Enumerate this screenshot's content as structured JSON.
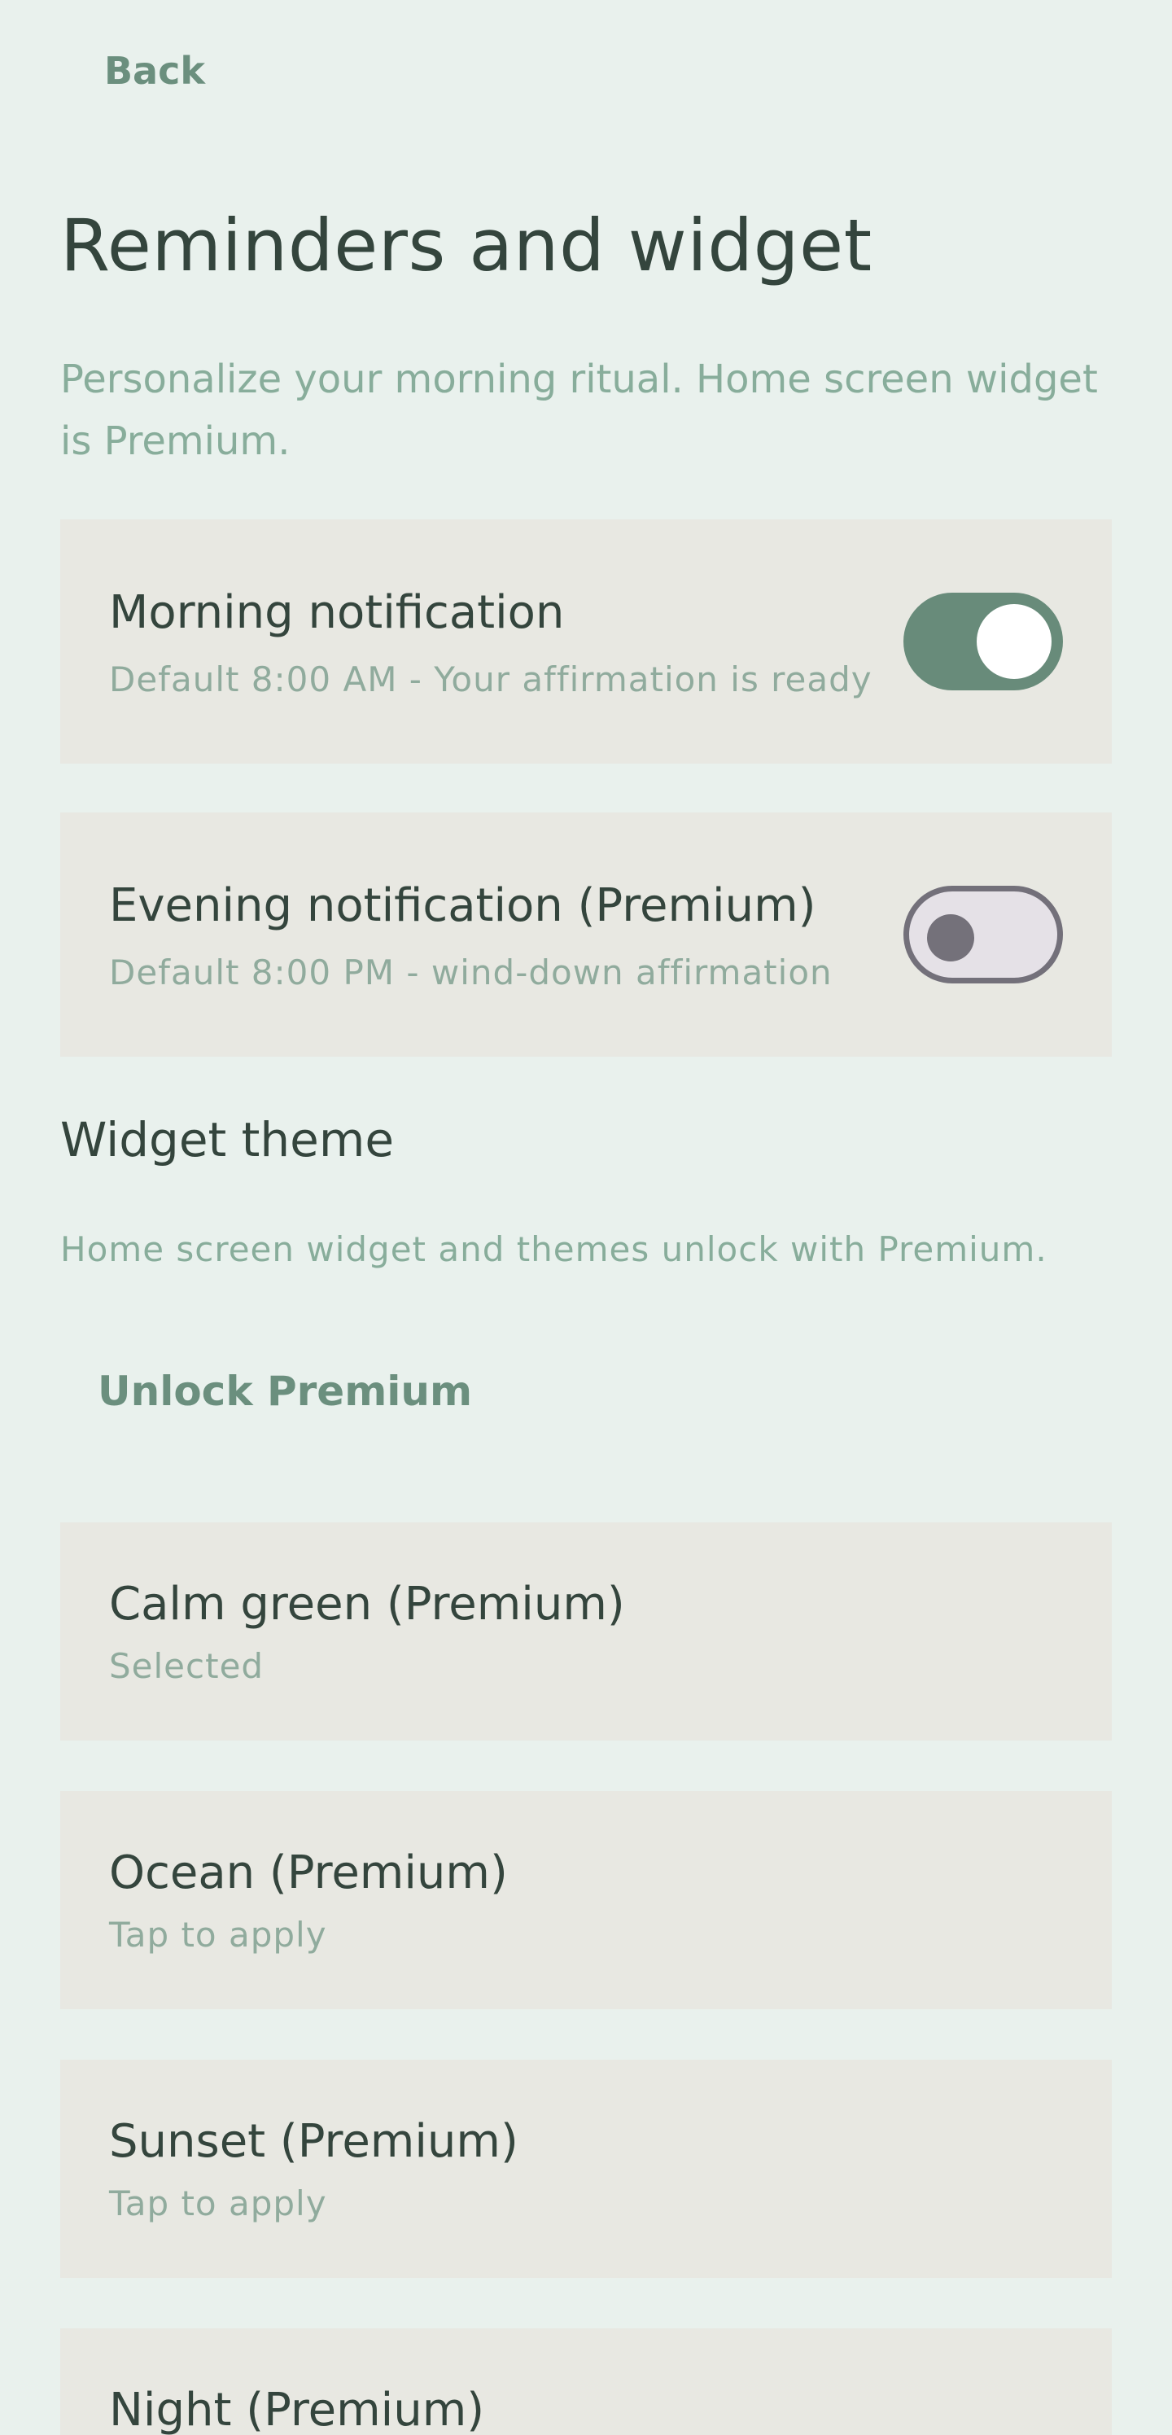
{
  "header": {
    "back_label": "Back",
    "title": "Reminders and widget",
    "subtitle": "Personalize your morning ritual. Home screen widget is Premium."
  },
  "notifications": [
    {
      "title": "Morning notification",
      "subtitle": "Default 8:00 AM - Your affirmation is ready",
      "enabled": true
    },
    {
      "title": "Evening notification (Premium)",
      "subtitle": "Default 8:00 PM - wind-down affirmation",
      "enabled": false
    }
  ],
  "widget_theme": {
    "heading": "Widget theme",
    "note": "Home screen widget and themes unlock with Premium.",
    "unlock_label": "Unlock Premium",
    "themes": [
      {
        "title": "Calm green (Premium)",
        "subtitle": "Selected"
      },
      {
        "title": "Ocean (Premium)",
        "subtitle": "Tap to apply"
      },
      {
        "title": "Sunset (Premium)",
        "subtitle": "Tap to apply"
      },
      {
        "title": "Night (Premium)",
        "subtitle": ""
      }
    ]
  },
  "colors": {
    "background": "#e9f1ed",
    "card": "#e8e8e2",
    "accent": "#688b7a",
    "title_text": "#34453d",
    "muted_text": "#88ad9b"
  }
}
